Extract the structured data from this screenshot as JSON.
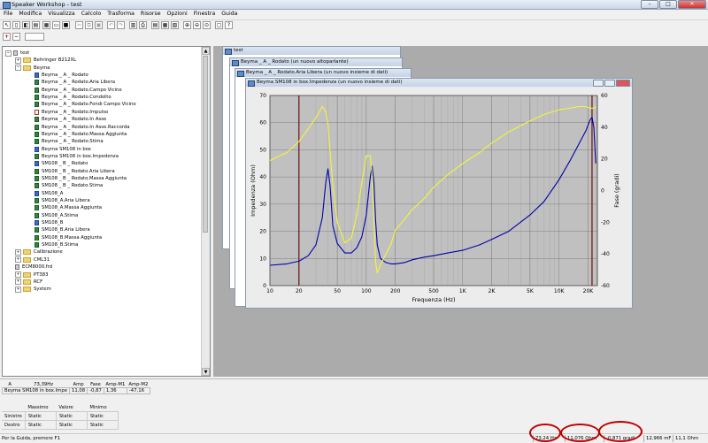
{
  "app": {
    "title": "Speaker Workshop - test"
  },
  "window_buttons": {
    "minimize": "–",
    "maximize": "□",
    "close": "✕"
  },
  "menu": [
    "File",
    "Modifica",
    "Visualizza",
    "Calcolo",
    "Trasforma",
    "Risorse",
    "Opzioni",
    "Finestra",
    "Guida"
  ],
  "tree": {
    "root": "test",
    "items": [
      {
        "label": "Behringer B212XL",
        "kind": "folder",
        "level": 1
      },
      {
        "label": "Beyma",
        "kind": "folder",
        "level": 1
      },
      {
        "label": "Beyma _ A _ Rodato",
        "kind": "driver",
        "level": 2
      },
      {
        "label": "Beyma _ A _ Rodato.Aria Libera",
        "kind": "curve",
        "level": 2
      },
      {
        "label": "Beyma _ A _ Rodato.Campo Vicino",
        "kind": "curve",
        "level": 2
      },
      {
        "label": "Beyma _ A _ Rodato.Condotto",
        "kind": "curve",
        "level": 2
      },
      {
        "label": "Beyma _ A _ Rodato.Fondi Campo Vicino",
        "kind": "curve",
        "level": 2
      },
      {
        "label": "Beyma _ A _ Rodato.Impulso",
        "kind": "impulse",
        "level": 2
      },
      {
        "label": "Beyma _ A _ Rodato.In Asse",
        "kind": "curve",
        "level": 2
      },
      {
        "label": "Beyma _ A _ Rodato.In Asse.Raccorda",
        "kind": "curve",
        "level": 2
      },
      {
        "label": "Beyma _ A _ Rodato.Massa Aggiunta",
        "kind": "curve",
        "level": 2
      },
      {
        "label": "Beyma _ A _ Rodato.Stima",
        "kind": "curve",
        "level": 2
      },
      {
        "label": "Beyma SM108 in box",
        "kind": "box",
        "level": 2
      },
      {
        "label": "Beyma SM108 in box.Impedenza",
        "kind": "curve",
        "level": 2
      },
      {
        "label": "SM108 _ B _ Rodato",
        "kind": "driver",
        "level": 2
      },
      {
        "label": "SM108 _ B _ Rodato.Aria Libera",
        "kind": "curve",
        "level": 2
      },
      {
        "label": "SM108 _ B _ Rodato.Massa Aggiunta",
        "kind": "curve",
        "level": 2
      },
      {
        "label": "SM108 _ B _ Rodato.Stima",
        "kind": "curve",
        "level": 2
      },
      {
        "label": "SM108_A",
        "kind": "driver",
        "level": 2
      },
      {
        "label": "SM108_A.Aria Libera",
        "kind": "curve",
        "level": 2
      },
      {
        "label": "SM108_A.Massa Aggiunta",
        "kind": "curve",
        "level": 2
      },
      {
        "label": "SM108_A.Stima",
        "kind": "curve",
        "level": 2
      },
      {
        "label": "SM108_B",
        "kind": "driver",
        "level": 2
      },
      {
        "label": "SM108_B.Aria Libera",
        "kind": "curve",
        "level": 2
      },
      {
        "label": "SM108_B.Massa Aggiunta",
        "kind": "curve",
        "level": 2
      },
      {
        "label": "SM108_B.Stima",
        "kind": "curve",
        "level": 2
      },
      {
        "label": "Calibrazione",
        "kind": "folder",
        "level": 1
      },
      {
        "label": "CML31",
        "kind": "folder",
        "level": 1
      },
      {
        "label": "ECM8000.frd",
        "kind": "file",
        "level": 1
      },
      {
        "label": "PT383",
        "kind": "folder",
        "level": 1
      },
      {
        "label": "RCF",
        "kind": "folder",
        "level": 1
      },
      {
        "label": "System",
        "kind": "folder",
        "level": 1
      }
    ]
  },
  "windows": {
    "back1": "test",
    "back2": "Beyma _ A _ Rodato (un nuovo altoparlante)",
    "back3": "Beyma _ A _ Rodato.Aria Libera (un nuovo insieme di dati)",
    "front": "Beyma SM108 in box.Impedenza (un nuovo insieme di dati)"
  },
  "chart_data": {
    "type": "line",
    "xlabel": "Frequenza (Hz)",
    "ylabel": "Impedenza (Ohm)",
    "y2label": "Fase (gradi)",
    "xscale": "log",
    "xlim": [
      10,
      25000
    ],
    "ylim": [
      0,
      70
    ],
    "y2lim": [
      -60,
      60
    ],
    "x_ticks": [
      "10",
      "20",
      "50",
      "100",
      "200",
      "500",
      "1K",
      "2K",
      "5K",
      "10K",
      "20K"
    ],
    "y_ticks": [
      "0",
      "10",
      "20",
      "30",
      "40",
      "50",
      "60",
      "70"
    ],
    "y2_ticks": [
      "-60",
      "-40",
      "-20",
      "0",
      "20",
      "40",
      "60"
    ],
    "markers_hz": [
      20,
      22000
    ],
    "series": [
      {
        "axis": "y",
        "color": "#0000a8",
        "x": [
          10,
          15,
          20,
          25,
          30,
          35,
          38,
          40,
          42,
          45,
          50,
          60,
          70,
          80,
          90,
          100,
          110,
          115,
          120,
          125,
          130,
          140,
          160,
          180,
          200,
          250,
          300,
          400,
          500,
          700,
          1000,
          1500,
          2000,
          3000,
          5000,
          7000,
          10000,
          13000,
          16000,
          19000,
          21000,
          22000,
          23000,
          24000
        ],
        "values": [
          7.5,
          8.0,
          9.0,
          11,
          15,
          25,
          38,
          43,
          37,
          22,
          15.5,
          12,
          12,
          14,
          18,
          26,
          40,
          44,
          38,
          24,
          15,
          10,
          8.5,
          8.0,
          8.0,
          8.5,
          9.5,
          10.5,
          11,
          12,
          13,
          15,
          17,
          20,
          26,
          31,
          39,
          46,
          52,
          57,
          61,
          62,
          58,
          45
        ]
      },
      {
        "axis": "y2",
        "color": "#f4f43c",
        "x": [
          10,
          15,
          20,
          25,
          30,
          35,
          38,
          40,
          42,
          45,
          50,
          60,
          70,
          80,
          90,
          100,
          110,
          115,
          120,
          125,
          130,
          140,
          160,
          180,
          200,
          250,
          300,
          400,
          500,
          700,
          1000,
          1500,
          2000,
          3000,
          5000,
          7000,
          10000,
          13000,
          16000,
          19000,
          21000,
          22000,
          23000,
          24000
        ],
        "values": [
          19,
          24,
          31,
          39,
          46,
          53,
          50,
          42,
          25,
          3,
          -20,
          -33,
          -30,
          -15,
          5,
          22,
          22,
          10,
          -20,
          -45,
          -52,
          -47,
          -40,
          -34,
          -25,
          -18,
          -12,
          -5,
          2,
          10,
          17,
          24,
          30,
          37,
          44,
          48,
          51,
          52,
          53,
          53,
          52,
          52,
          52,
          53
        ]
      }
    ]
  },
  "cursor_table": {
    "headers": [
      "A",
      "73,39Hz",
      "Amp",
      "Fase",
      "Amp-M1",
      "Amp-M2"
    ],
    "row": [
      "Beyma SM108 in box.Impe",
      "11,08",
      "-0,87",
      "1,36",
      "-47,16"
    ]
  },
  "markers_table": {
    "headers": [
      "Massimo",
      "Valore",
      "Minimo"
    ],
    "rows": [
      {
        "label": "Sinistro",
        "massimo": "Static",
        "valore": "Static",
        "minimo": "Static"
      },
      {
        "label": "Destro",
        "massimo": "Static",
        "valore": "Static",
        "minimo": "Static"
      }
    ]
  },
  "status": {
    "help": "Per la Guida, premere F1",
    "freq": "73,24 Hz",
    "ohm": "11,076 Ohm",
    "deg": "-0,871 gradi",
    "cap": "12,966 mF",
    "res": "11,1 Ohm"
  },
  "highlight_color": "#c00000"
}
